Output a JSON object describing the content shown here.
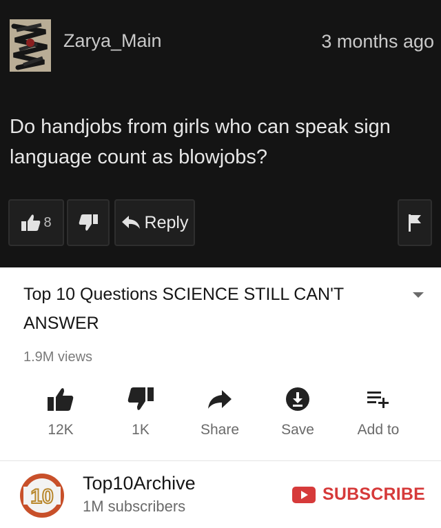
{
  "comment": {
    "username": "Zarya_Main",
    "timestamp": "3 months ago",
    "text": "Do handjobs from girls who can speak sign language count as blowjobs?",
    "like_count": "8",
    "reply_label": "Reply",
    "icons": [
      "thumbs-up-icon",
      "thumbs-down-icon",
      "reply-icon",
      "flag-icon"
    ]
  },
  "video": {
    "title": "Top 10 Questions SCIENCE STILL CAN'T ANSWER",
    "views": "1.9M views",
    "actions": [
      {
        "icon": "like-icon",
        "label": "12K"
      },
      {
        "icon": "dislike-icon",
        "label": "1K"
      },
      {
        "icon": "share-icon",
        "label": "Share"
      },
      {
        "icon": "save-icon",
        "label": "Save"
      },
      {
        "icon": "add-to-playlist-icon",
        "label": "Add to"
      }
    ]
  },
  "channel": {
    "name": "Top10Archive",
    "subscribers": "1M subscribers",
    "logo_text": "10",
    "subscribe_label": "SUBSCRIBE"
  },
  "colors": {
    "comment_bg": "#141414",
    "accent_red": "#d63a3a"
  }
}
